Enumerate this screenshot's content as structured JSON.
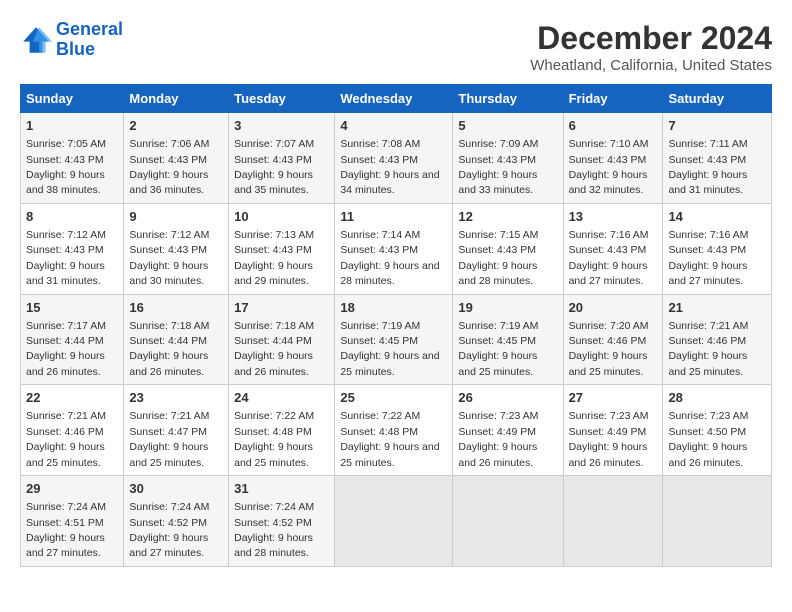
{
  "logo": {
    "line1": "General",
    "line2": "Blue"
  },
  "title": "December 2024",
  "subtitle": "Wheatland, California, United States",
  "headers": [
    "Sunday",
    "Monday",
    "Tuesday",
    "Wednesday",
    "Thursday",
    "Friday",
    "Saturday"
  ],
  "weeks": [
    [
      {
        "day": "1",
        "sunrise": "7:05 AM",
        "sunset": "4:43 PM",
        "daylight": "9 hours and 38 minutes."
      },
      {
        "day": "2",
        "sunrise": "7:06 AM",
        "sunset": "4:43 PM",
        "daylight": "9 hours and 36 minutes."
      },
      {
        "day": "3",
        "sunrise": "7:07 AM",
        "sunset": "4:43 PM",
        "daylight": "9 hours and 35 minutes."
      },
      {
        "day": "4",
        "sunrise": "7:08 AM",
        "sunset": "4:43 PM",
        "daylight": "9 hours and 34 minutes."
      },
      {
        "day": "5",
        "sunrise": "7:09 AM",
        "sunset": "4:43 PM",
        "daylight": "9 hours and 33 minutes."
      },
      {
        "day": "6",
        "sunrise": "7:10 AM",
        "sunset": "4:43 PM",
        "daylight": "9 hours and 32 minutes."
      },
      {
        "day": "7",
        "sunrise": "7:11 AM",
        "sunset": "4:43 PM",
        "daylight": "9 hours and 31 minutes."
      }
    ],
    [
      {
        "day": "8",
        "sunrise": "7:12 AM",
        "sunset": "4:43 PM",
        "daylight": "9 hours and 31 minutes."
      },
      {
        "day": "9",
        "sunrise": "7:12 AM",
        "sunset": "4:43 PM",
        "daylight": "9 hours and 30 minutes."
      },
      {
        "day": "10",
        "sunrise": "7:13 AM",
        "sunset": "4:43 PM",
        "daylight": "9 hours and 29 minutes."
      },
      {
        "day": "11",
        "sunrise": "7:14 AM",
        "sunset": "4:43 PM",
        "daylight": "9 hours and 28 minutes."
      },
      {
        "day": "12",
        "sunrise": "7:15 AM",
        "sunset": "4:43 PM",
        "daylight": "9 hours and 28 minutes."
      },
      {
        "day": "13",
        "sunrise": "7:16 AM",
        "sunset": "4:43 PM",
        "daylight": "9 hours and 27 minutes."
      },
      {
        "day": "14",
        "sunrise": "7:16 AM",
        "sunset": "4:43 PM",
        "daylight": "9 hours and 27 minutes."
      }
    ],
    [
      {
        "day": "15",
        "sunrise": "7:17 AM",
        "sunset": "4:44 PM",
        "daylight": "9 hours and 26 minutes."
      },
      {
        "day": "16",
        "sunrise": "7:18 AM",
        "sunset": "4:44 PM",
        "daylight": "9 hours and 26 minutes."
      },
      {
        "day": "17",
        "sunrise": "7:18 AM",
        "sunset": "4:44 PM",
        "daylight": "9 hours and 26 minutes."
      },
      {
        "day": "18",
        "sunrise": "7:19 AM",
        "sunset": "4:45 PM",
        "daylight": "9 hours and 25 minutes."
      },
      {
        "day": "19",
        "sunrise": "7:19 AM",
        "sunset": "4:45 PM",
        "daylight": "9 hours and 25 minutes."
      },
      {
        "day": "20",
        "sunrise": "7:20 AM",
        "sunset": "4:46 PM",
        "daylight": "9 hours and 25 minutes."
      },
      {
        "day": "21",
        "sunrise": "7:21 AM",
        "sunset": "4:46 PM",
        "daylight": "9 hours and 25 minutes."
      }
    ],
    [
      {
        "day": "22",
        "sunrise": "7:21 AM",
        "sunset": "4:46 PM",
        "daylight": "9 hours and 25 minutes."
      },
      {
        "day": "23",
        "sunrise": "7:21 AM",
        "sunset": "4:47 PM",
        "daylight": "9 hours and 25 minutes."
      },
      {
        "day": "24",
        "sunrise": "7:22 AM",
        "sunset": "4:48 PM",
        "daylight": "9 hours and 25 minutes."
      },
      {
        "day": "25",
        "sunrise": "7:22 AM",
        "sunset": "4:48 PM",
        "daylight": "9 hours and 25 minutes."
      },
      {
        "day": "26",
        "sunrise": "7:23 AM",
        "sunset": "4:49 PM",
        "daylight": "9 hours and 26 minutes."
      },
      {
        "day": "27",
        "sunrise": "7:23 AM",
        "sunset": "4:49 PM",
        "daylight": "9 hours and 26 minutes."
      },
      {
        "day": "28",
        "sunrise": "7:23 AM",
        "sunset": "4:50 PM",
        "daylight": "9 hours and 26 minutes."
      }
    ],
    [
      {
        "day": "29",
        "sunrise": "7:24 AM",
        "sunset": "4:51 PM",
        "daylight": "9 hours and 27 minutes."
      },
      {
        "day": "30",
        "sunrise": "7:24 AM",
        "sunset": "4:52 PM",
        "daylight": "9 hours and 27 minutes."
      },
      {
        "day": "31",
        "sunrise": "7:24 AM",
        "sunset": "4:52 PM",
        "daylight": "9 hours and 28 minutes."
      },
      null,
      null,
      null,
      null
    ]
  ],
  "labels": {
    "sunrise": "Sunrise:",
    "sunset": "Sunset:",
    "daylight": "Daylight:"
  }
}
